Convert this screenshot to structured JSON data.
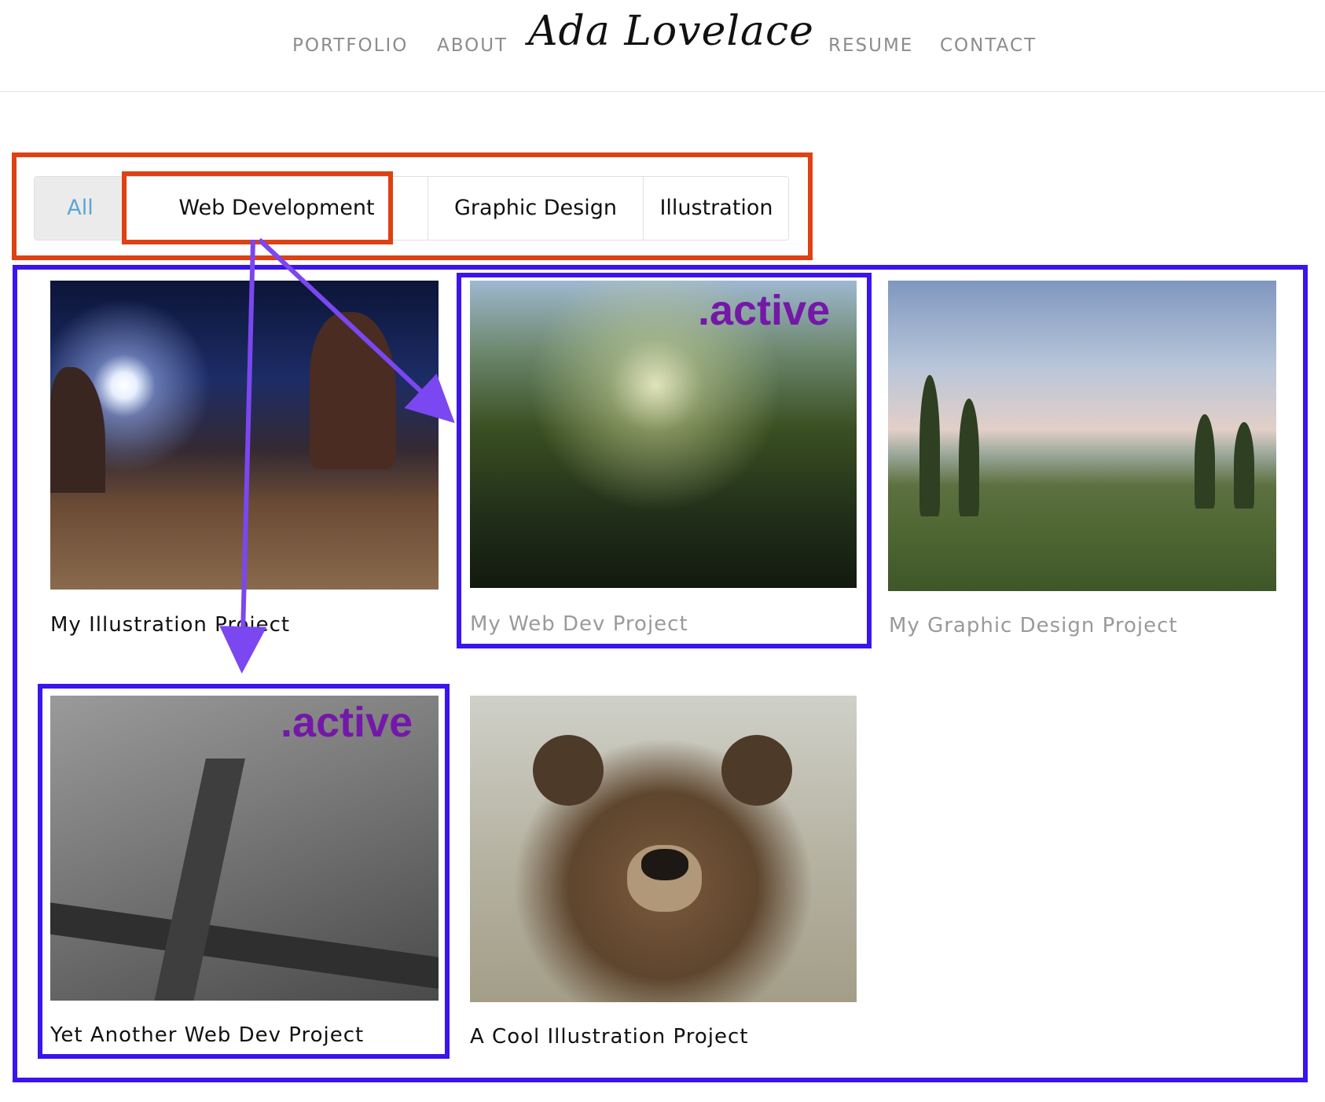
{
  "header": {
    "nav_left": [
      "PORTFOLIO",
      "ABOUT"
    ],
    "logo": "Ada Lovelace",
    "nav_right": [
      "RESUME",
      "CONTACT"
    ]
  },
  "filters": {
    "tabs": [
      "All",
      "Web Development",
      "Graphic Design",
      "Illustration"
    ],
    "selected": "All"
  },
  "projects": [
    {
      "title": "My Illustration Project",
      "image": "night-desert-landscape"
    },
    {
      "title": "My Web Dev Project",
      "image": "meadow-grass-sunlight"
    },
    {
      "title": "My Graphic Design Project",
      "image": "marshland-trees"
    },
    {
      "title": "Yet Another Web Dev Project",
      "image": "suspension-bridge-aerial"
    },
    {
      "title": "A Cool Illustration Project",
      "image": "brown-bear"
    }
  ],
  "annotations": {
    "active_label": ".active",
    "colors": {
      "red": "#de4114",
      "blue": "#3b14ee",
      "purple": "#7418a8",
      "arrow": "#7b47f0"
    }
  }
}
